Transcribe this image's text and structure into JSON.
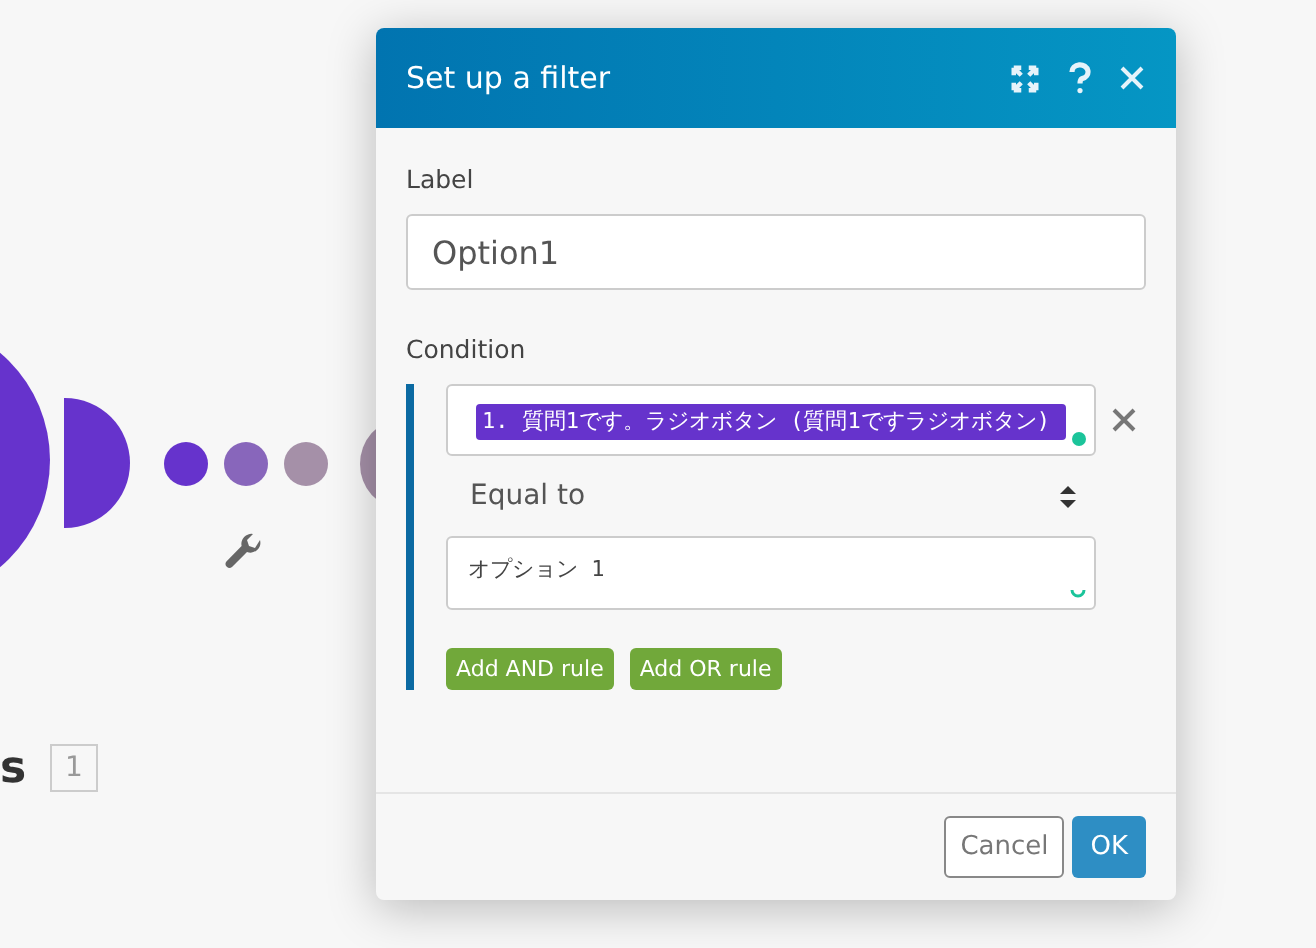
{
  "canvas": {
    "module_name": "s",
    "module_badge": "1"
  },
  "dialog": {
    "title": "Set up a filter",
    "label_field": {
      "caption": "Label",
      "value": "Option1"
    },
    "condition": {
      "caption": "Condition",
      "rules": [
        {
          "operand": "1. 質問1です。ラジオボタン (質問1ですラジオボタン)",
          "operator": "Equal to",
          "value": "オプション 1"
        }
      ],
      "add_buttons": [
        {
          "label": "Add AND rule"
        },
        {
          "label": "Add OR rule"
        }
      ]
    },
    "footer": {
      "cancel": "Cancel",
      "ok": "OK"
    }
  }
}
